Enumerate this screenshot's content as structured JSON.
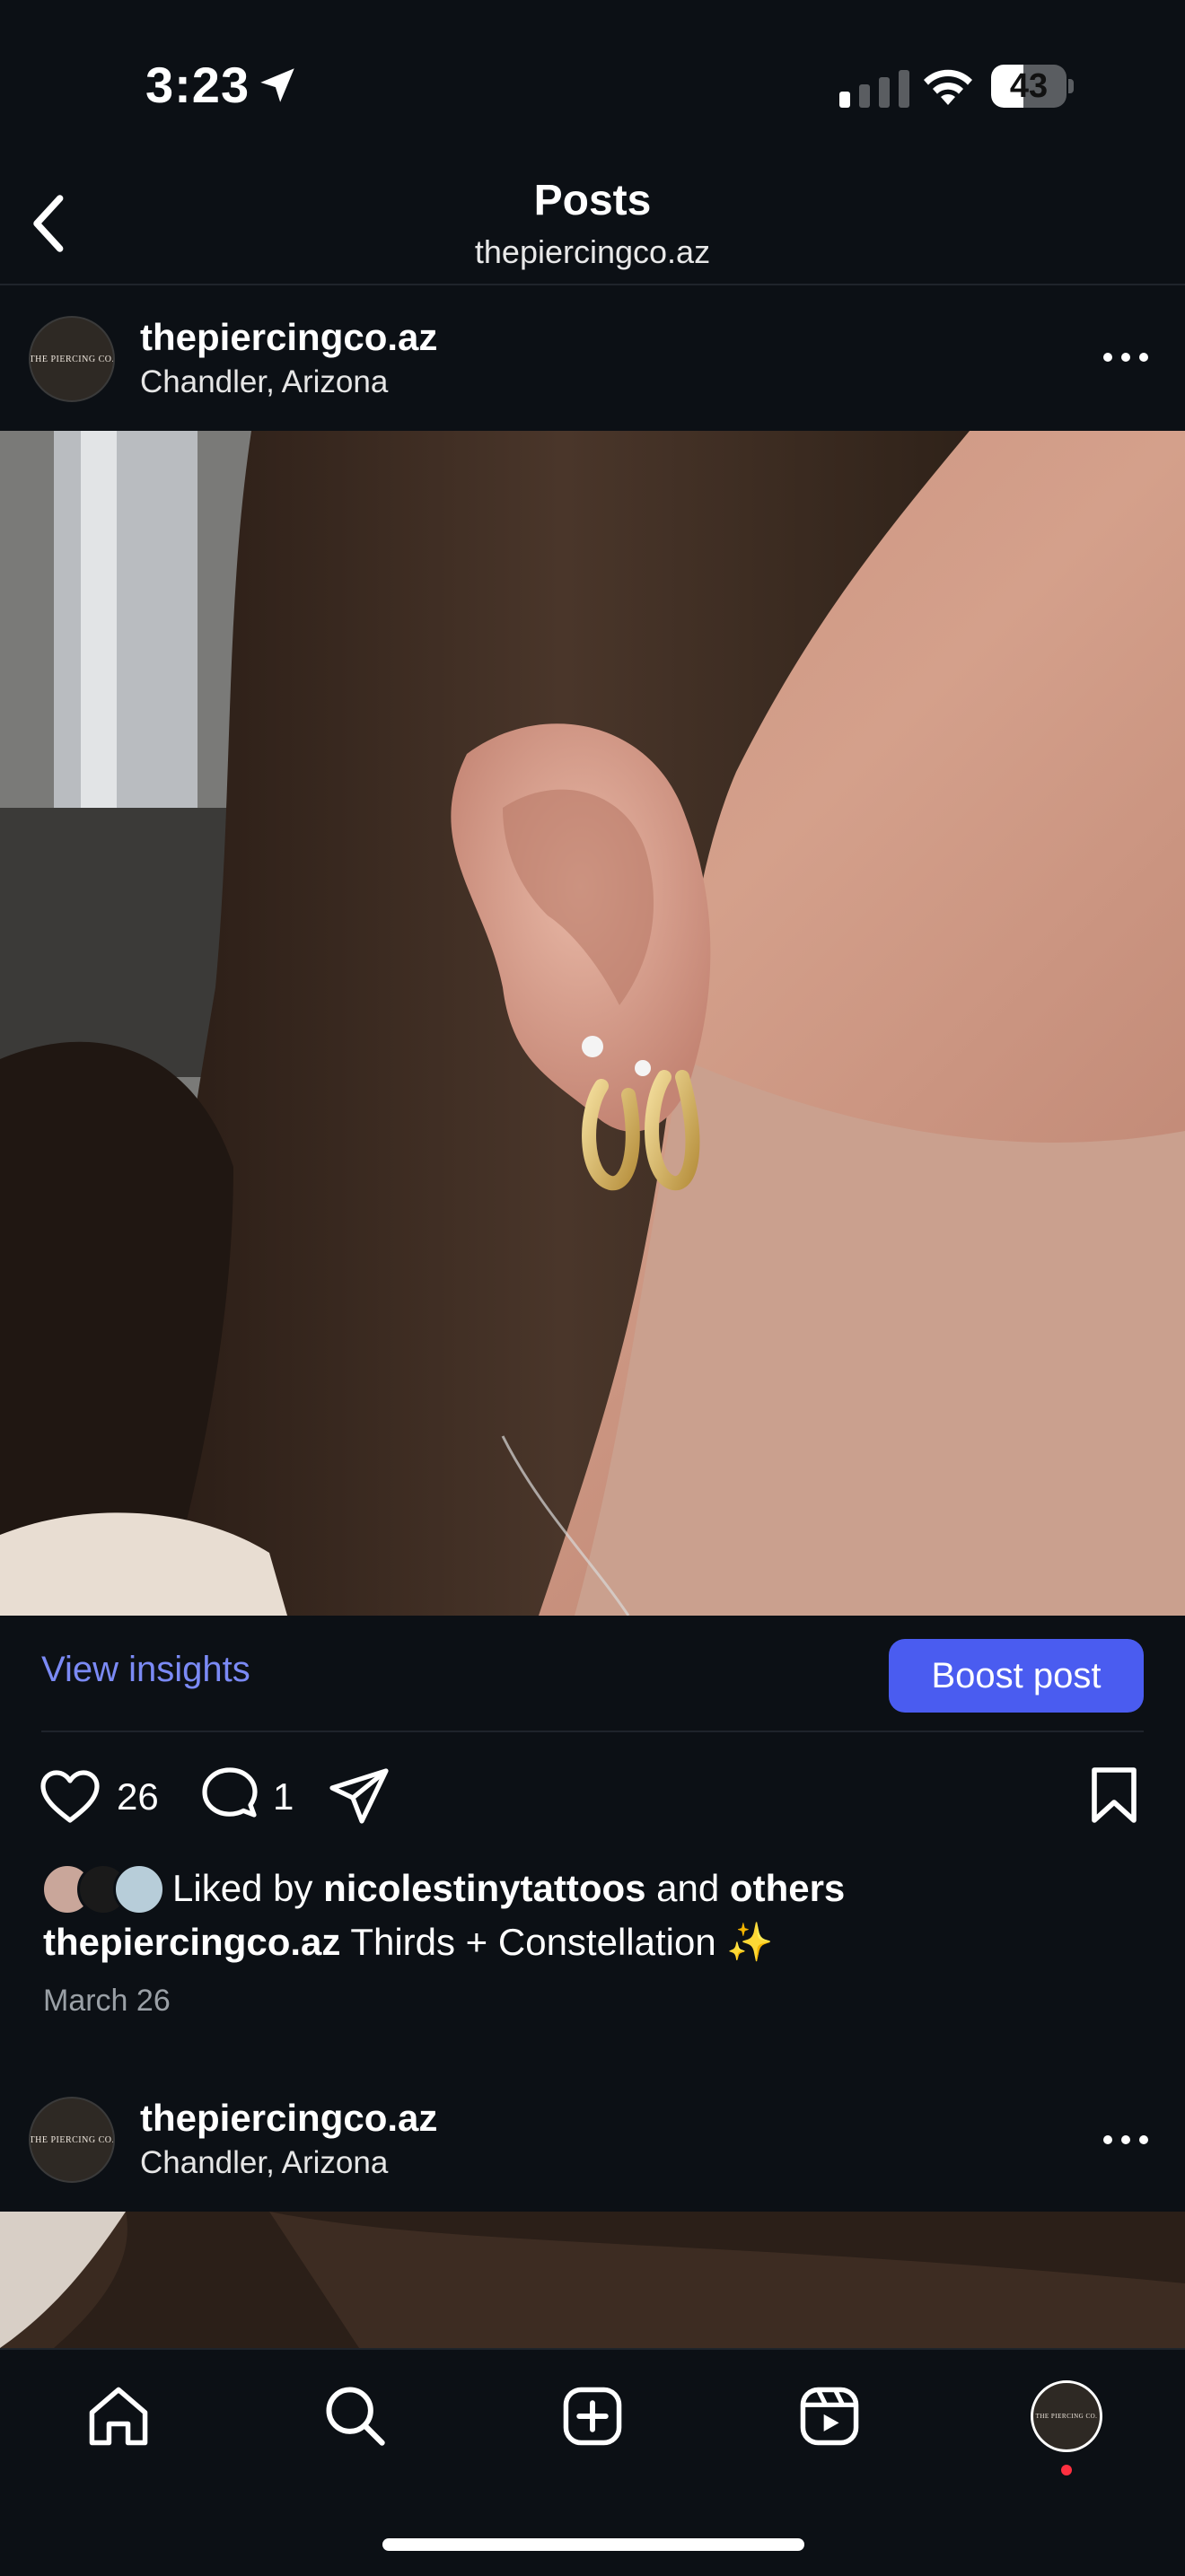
{
  "status_bar": {
    "time": "3:23",
    "battery": "43",
    "battery_level": 0.43
  },
  "header": {
    "title": "Posts",
    "subtitle": "thepiercingco.az"
  },
  "post": {
    "username": "thepiercingco.az",
    "location": "Chandler, Arizona",
    "avatar_text": "THE PIERCING CO.",
    "view_insights_label": "View insights",
    "boost_label": "Boost post",
    "like_count": "26",
    "comment_count": "1",
    "liked_by_prefix": "Liked by",
    "liked_by_user": "nicolestinytattoos",
    "liked_by_and": "and",
    "liked_by_others": "others",
    "caption_user": "thepiercingco.az",
    "caption_text": "Thirds + Constellation ✨",
    "date": "March 26"
  },
  "next_post": {
    "username": "thepiercingco.az",
    "location": "Chandler, Arizona",
    "avatar_text": "THE PIERCING CO."
  },
  "bottom_nav": {
    "items": [
      "home-icon",
      "search-icon",
      "create-icon",
      "reels-icon",
      "profile-avatar"
    ]
  },
  "colors": {
    "background": "#0c1015",
    "link": "#7b8af5",
    "boost_button": "#4a5cf0",
    "notification_dot": "#ff3040"
  }
}
